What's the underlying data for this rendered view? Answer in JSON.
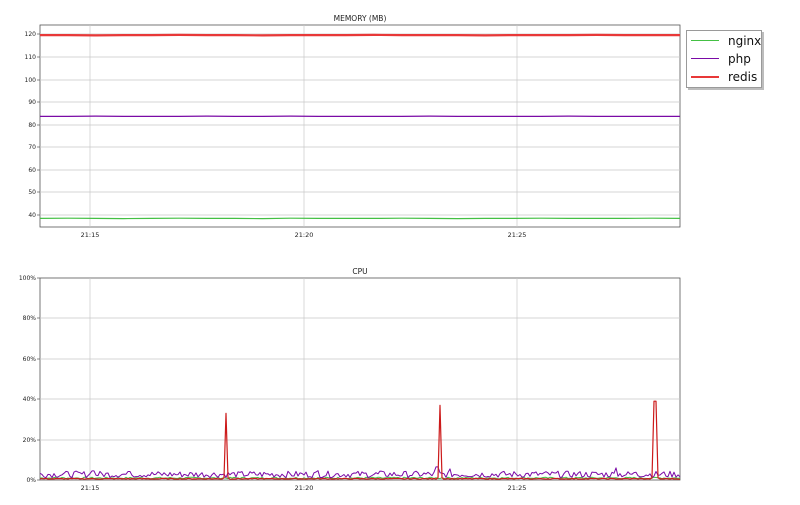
{
  "chart_data": [
    {
      "type": "line",
      "title": "MEMORY (MB)",
      "xlabel": "",
      "ylabel": "",
      "x_ticks": [
        "21:15",
        "21:20",
        "21:25"
      ],
      "y_ticks": [
        "40",
        "50",
        "60",
        "70",
        "80",
        "90",
        "100",
        "110",
        "120"
      ],
      "ylim": [
        35,
        123
      ],
      "grid": true,
      "legend_position": "right",
      "series": [
        {
          "name": "nginx",
          "color": "#44c044",
          "width": 1.2,
          "values": [
            38.5,
            38.6,
            38.5,
            38.4,
            38.5,
            38.6,
            38.5,
            38.5,
            38.4,
            38.6,
            38.5,
            38.5,
            38.5,
            38.6,
            38.5,
            38.4,
            38.5,
            38.5,
            38.6,
            38.5,
            38.5,
            38.5,
            38.6,
            38.5
          ]
        },
        {
          "name": "php",
          "color": "#7a0aa6",
          "width": 1.3,
          "values": [
            83.6,
            83.6,
            83.7,
            83.6,
            83.6,
            83.6,
            83.7,
            83.6,
            83.6,
            83.7,
            83.6,
            83.6,
            83.6,
            83.6,
            83.7,
            83.6,
            83.6,
            83.6,
            83.6,
            83.7,
            83.6,
            83.6,
            83.6,
            83.6
          ]
        },
        {
          "name": "redis",
          "color": "#e83838",
          "width": 2.2,
          "values": [
            119.5,
            119.5,
            119.4,
            119.5,
            119.5,
            119.6,
            119.5,
            119.5,
            119.4,
            119.5,
            119.5,
            119.5,
            119.6,
            119.5,
            119.5,
            119.5,
            119.4,
            119.5,
            119.5,
            119.5,
            119.6,
            119.5,
            119.5,
            119.5
          ]
        }
      ]
    },
    {
      "type": "line",
      "title": "CPU",
      "xlabel": "",
      "ylabel": "",
      "x_ticks": [
        "21:15",
        "21:20",
        "21:25"
      ],
      "y_ticks": [
        "0%",
        "20%",
        "40%",
        "60%",
        "80%",
        "100%"
      ],
      "ylim": [
        0,
        100
      ],
      "grid": true,
      "series": [
        {
          "name": "nginx",
          "color": "#44c044",
          "width": 1.0,
          "baseline": 1.0,
          "noise": 0.4,
          "spikes": []
        },
        {
          "name": "php",
          "color": "#7a0aa6",
          "width": 1.0,
          "baseline": 2.8,
          "noise": 1.6,
          "spikes": [
            {
              "t": 0.083,
              "v": 4.5
            },
            {
              "t": 0.14,
              "v": 4.2
            },
            {
              "t": 0.31,
              "v": 4.0
            },
            {
              "t": 0.435,
              "v": 4.6
            },
            {
              "t": 0.53,
              "v": 4.4
            },
            {
              "t": 0.62,
              "v": 6.5
            },
            {
              "t": 0.64,
              "v": 5.5
            },
            {
              "t": 0.9,
              "v": 6.0
            },
            {
              "t": 0.93,
              "v": 3.8
            }
          ]
        },
        {
          "name": "redis",
          "color": "#cc1a1a",
          "width": 1.2,
          "baseline": 0.6,
          "noise": 0.2,
          "spikes": [
            {
              "t": 0.291,
              "v": 33
            },
            {
              "t": 0.626,
              "v": 37
            },
            {
              "t": 0.961,
              "v": 39
            }
          ]
        }
      ]
    }
  ],
  "legend": {
    "items": [
      {
        "label": "nginx",
        "color": "#44c044",
        "width": 1.2
      },
      {
        "label": "php",
        "color": "#7a0aa6",
        "width": 1.3
      },
      {
        "label": "redis",
        "color": "#e83838",
        "width": 2.2
      }
    ]
  }
}
